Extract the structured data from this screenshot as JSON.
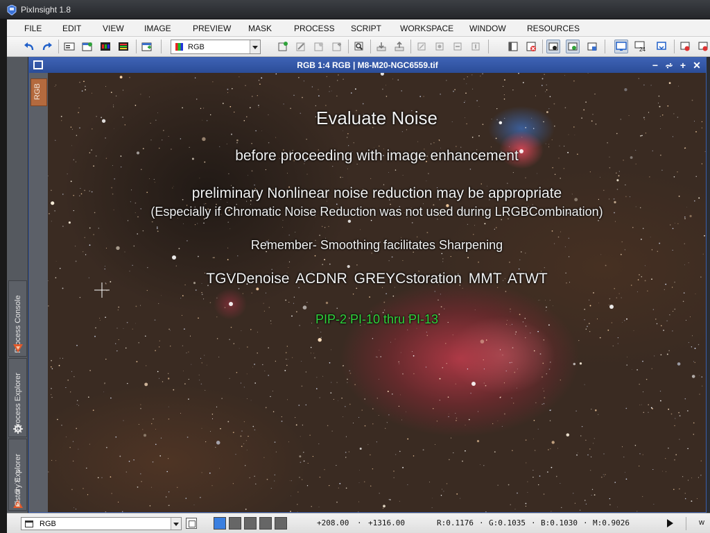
{
  "app": {
    "title": "PixInsight 1.8"
  },
  "menu": [
    "FILE",
    "EDIT",
    "VIEW",
    "IMAGE",
    "PREVIEW",
    "MASK",
    "PROCESS",
    "SCRIPT",
    "WORKSPACE",
    "WINDOW",
    "RESOURCES"
  ],
  "toolbar": {
    "view_select": "RGB"
  },
  "left_dock": {
    "process_console": "Process Console",
    "process_explorer": "Process Explorer",
    "history_explorer": "History Explorer"
  },
  "image_window": {
    "title": "RGB 1:4 RGB | M8-M20-NGC6559.tif",
    "view_tab": "RGB",
    "controls": {
      "minimize": "−",
      "shade": "⩫",
      "maximize": "+",
      "close": "✕"
    }
  },
  "overlay": {
    "title": "Evaluate Noise",
    "subtitle": "before proceeding with image enhancement",
    "preliminary": "preliminary Nonlinear noise reduction may be appropriate",
    "especially": "(Especially if Chromatic Noise Reduction was not used during LRGBCombination)",
    "remember": "Remember- Smoothing facilitates Sharpening",
    "tools": "TGVDenoise  ACDNR  GREYCstoration  MMT  ATWT",
    "pip": "PIP-2 PI-10 thru PI-13"
  },
  "status": {
    "view_select": "RGB",
    "x": "+208.00",
    "y": "+1316.00",
    "r": "R:0.1176",
    "g": "G:0.1035",
    "b": "B:0.1030",
    "m": "M:0.9026",
    "sep": "·",
    "w": "w"
  },
  "colors": {
    "accent": "#3e63b5",
    "pip_text": "#2fd43c",
    "view_tab": "#b46a3e"
  }
}
